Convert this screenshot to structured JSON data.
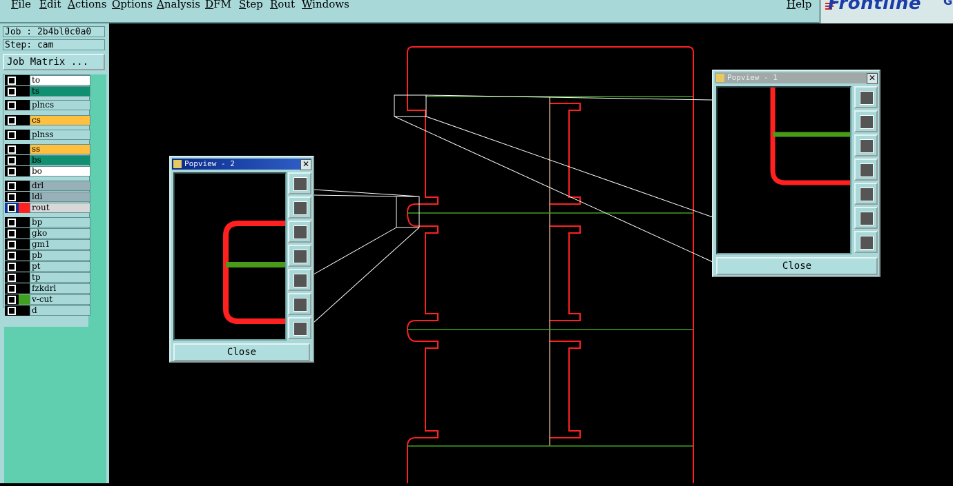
{
  "menu": {
    "items": [
      "File",
      "Edit",
      "Actions",
      "Options",
      "Analysis",
      "DFM",
      "Step",
      "Rout",
      "Windows"
    ],
    "help": "Help"
  },
  "logo": {
    "text": "Frontline",
    "tail": "G"
  },
  "job": {
    "label": "Job : 2b4bl0c0a0",
    "step": "Step: cam",
    "matrix_button": "Job Matrix ..."
  },
  "layers": [
    {
      "name": "to",
      "color": "#ffffff"
    },
    {
      "name": "ts",
      "color": "#109070"
    },
    {
      "name": "plncs",
      "color": "#a8d8d8"
    },
    {
      "name": "cs",
      "color": "#ffc040"
    },
    {
      "name": "plnss",
      "color": "#a8d8d8"
    },
    {
      "name": "ss",
      "color": "#ffc040"
    },
    {
      "name": "bs",
      "color": "#109070"
    },
    {
      "name": "bo",
      "color": "#ffffff"
    },
    {
      "name": "drl",
      "color": "#98b0b8"
    },
    {
      "name": "ldi",
      "color": "#98b0b8"
    },
    {
      "name": "rout",
      "color": "#d8d8d8"
    },
    {
      "name": "bp",
      "color": "#a8d8d8"
    },
    {
      "name": "gko",
      "color": "#a8d8d8"
    },
    {
      "name": "gm1",
      "color": "#a8d8d8"
    },
    {
      "name": "pb",
      "color": "#a8d8d8"
    },
    {
      "name": "pt",
      "color": "#a8d8d8"
    },
    {
      "name": "tp",
      "color": "#a8d8d8"
    },
    {
      "name": "fzkdrl",
      "color": "#a8d8d8"
    },
    {
      "name": "v-cut",
      "color": "#a8d8d8"
    },
    {
      "name": "d",
      "color": "#a8d8d8"
    }
  ],
  "popview1": {
    "title": "Popview - 1",
    "close": "Close"
  },
  "popview2": {
    "title": "Popview - 2",
    "close": "Close"
  },
  "colors": {
    "rout": "#ff2020",
    "vcut": "#40a020",
    "panel": "#a8d8d8"
  }
}
